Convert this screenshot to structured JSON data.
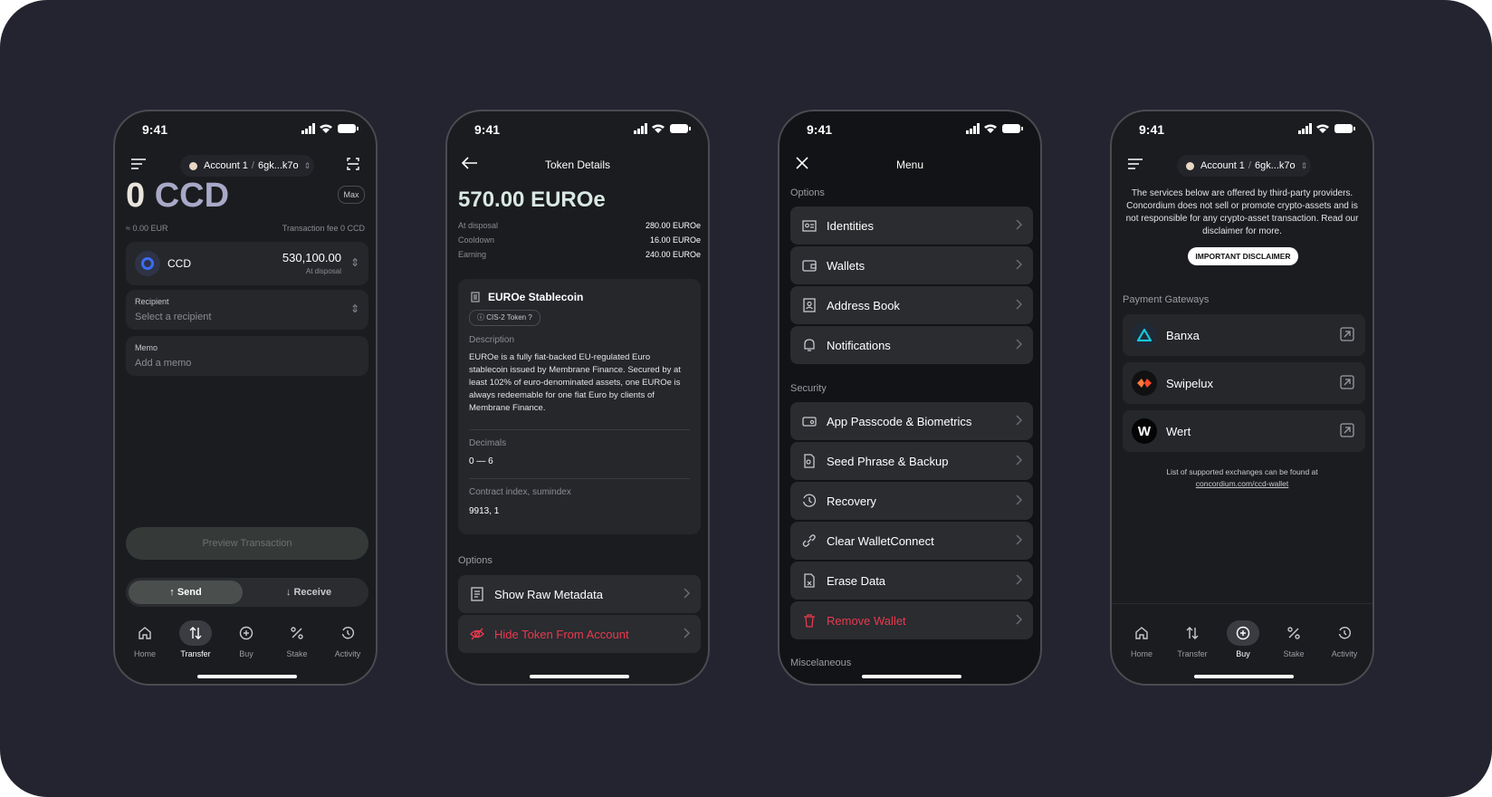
{
  "status_time": "9:41",
  "screen1": {
    "account_label": "Account 1",
    "account_address": "6gk...k7o",
    "amount_value": "0",
    "amount_currency": "CCD",
    "max_label": "Max",
    "fiat_value": "≈ 0.00 EUR",
    "fee_text": "Transaction fee 0 CCD",
    "token_name": "CCD",
    "token_balance": "530,100.00",
    "token_balance_label": "At disposal",
    "recipient_label": "Recipient",
    "recipient_placeholder": "Select a recipient",
    "memo_label": "Memo",
    "memo_placeholder": "Add a memo",
    "preview_label": "Preview Transaction",
    "send_label": "Send",
    "receive_label": "Receive"
  },
  "screen2": {
    "title": "Token Details",
    "balance": "570.00 EUROe",
    "rows": [
      {
        "label": "At disposal",
        "value": "280.00 EUROe"
      },
      {
        "label": "Cooldown",
        "value": "16.00 EUROe"
      },
      {
        "label": "Earning",
        "value": "240.00 EUROe"
      }
    ],
    "token_title": "EUROe Stablecoin",
    "token_badge": "CIS-2 Token",
    "description_label": "Description",
    "description_text": "EUROe is a fully fiat-backed EU-regulated Euro stablecoin issued by Membrane Finance. Secured by at least 102% of euro-denominated assets, one EUROe is always redeemable for one fiat Euro by clients of Membrane Finance.",
    "decimals_label": "Decimals",
    "decimals_value": "0 — 6",
    "contract_label": "Contract index, sumindex",
    "contract_value": "9913, 1",
    "options_label": "Options",
    "option_metadata": "Show Raw Metadata",
    "option_hide": "Hide Token From Account"
  },
  "screen3": {
    "title": "Menu",
    "options_label": "Options",
    "options": [
      "Identities",
      "Wallets",
      "Address Book",
      "Notifications"
    ],
    "security_label": "Security",
    "security": [
      "App Passcode & Biometrics",
      "Seed Phrase & Backup",
      "Recovery",
      "Clear WalletConnect",
      "Erase Data",
      "Remove Wallet"
    ],
    "misc_label": "Miscelaneous"
  },
  "screen4": {
    "account_label": "Account 1",
    "account_address": "6gk...k7o",
    "notice": "The services below are offered by third-party providers. Concordium does not sell or promote crypto-assets and is not responsible for any crypto-asset transaction. Read our disclaimer for more.",
    "disclaimer_button": "IMPORTANT DISCLAIMER",
    "gateways_label": "Payment Gateways",
    "gateways": [
      "Banxa",
      "Swipelux",
      "Wert"
    ],
    "footer_text": "List of supported exchanges can be found at",
    "footer_link": "concordium.com/ccd-wallet"
  },
  "tabs": [
    "Home",
    "Transfer",
    "Buy",
    "Stake",
    "Activity"
  ],
  "colors": {
    "background": "#23242f",
    "phone": "#1b1c1f",
    "danger": "#e8394e",
    "accent": "#3b6cf5"
  }
}
